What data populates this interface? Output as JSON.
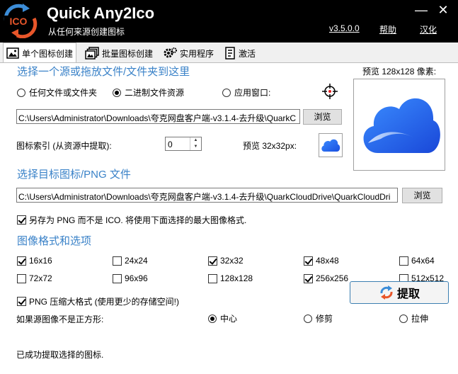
{
  "header": {
    "title": "Quick Any2Ico",
    "subtitle": "从任何来源创建图标",
    "logo_text": "ICO",
    "version": "v3.5.0.0",
    "help": "帮助",
    "language": "汉化",
    "minimize": "—",
    "close": "✕"
  },
  "tabs": [
    {
      "label": "单个图标创建",
      "icon": "image-icon"
    },
    {
      "label": "批量图标创建",
      "icon": "batch-icon"
    },
    {
      "label": "实用程序",
      "icon": "gear-icon"
    },
    {
      "label": "激活",
      "icon": "document-icon"
    }
  ],
  "source": {
    "title": "选择一个源或拖放文件/文件夹到这里",
    "options": [
      "任何文件或文件夹",
      "二进制文件资源",
      "应用窗口:"
    ],
    "selected": 1,
    "path": "C:\\Users\\Administrator\\Downloads\\夸克网盘客户端-v3.1.4-去升级\\QuarkC",
    "browse": "浏览",
    "index_label": "图标索引 (从资源中提取):",
    "index_value": "0",
    "preview32_label": "预览 32x32px:",
    "preview128_label": "预览 128x128 像素:"
  },
  "target": {
    "title": "选择目标图标/PNG 文件",
    "path": "C:\\Users\\Administrator\\Downloads\\夸克网盘客户端-v3.1.4-去升级\\QuarkCloudDrive\\QuarkCloudDri",
    "browse": "浏览",
    "save_png_label": "另存为 PNG 而不是 ICO. 将使用下面选择的最大图像格式.",
    "save_png_checked": true
  },
  "formats": {
    "title": "图像格式和选项",
    "sizes": [
      {
        "label": "16x16",
        "checked": true
      },
      {
        "label": "24x24",
        "checked": false
      },
      {
        "label": "32x32",
        "checked": true
      },
      {
        "label": "48x48",
        "checked": true
      },
      {
        "label": "64x64",
        "checked": false
      },
      {
        "label": "72x72",
        "checked": false
      },
      {
        "label": "96x96",
        "checked": false
      },
      {
        "label": "128x128",
        "checked": false
      },
      {
        "label": "256x256",
        "checked": true
      },
      {
        "label": "512x512",
        "checked": false
      }
    ],
    "png_compress_label": "PNG 压缩大格式 (使用更少的存储空间!)",
    "png_compress_checked": true,
    "nonsquare_label": "如果源图像不是正方形:",
    "nonsquare_options": [
      "中心",
      "修剪",
      "拉伸"
    ],
    "nonsquare_selected": 0
  },
  "footer": {
    "status": "已成功提取选择的图标.",
    "extract": "提取"
  },
  "colors": {
    "accent": "#3a82c8",
    "header_bg": "#000000",
    "cloud_blue": "#1e6af0"
  }
}
